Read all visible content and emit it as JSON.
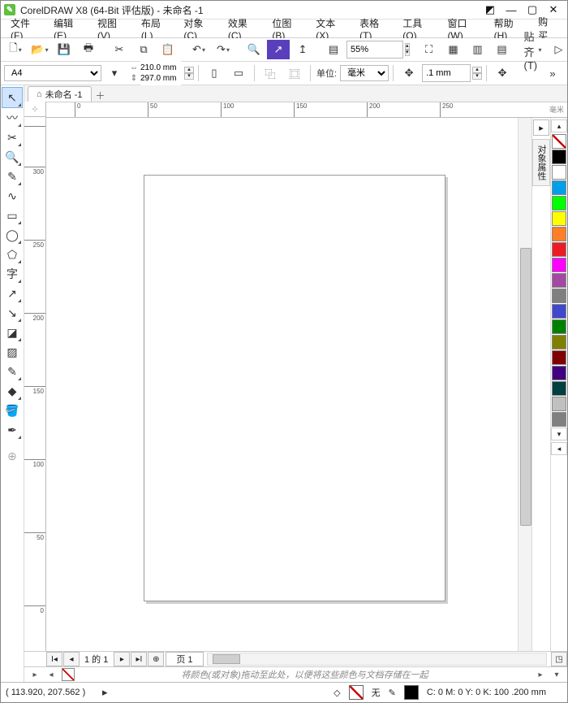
{
  "title": "CorelDRAW X8 (64-Bit 评估版) - 未命名 -1",
  "menu": [
    "文件(F)",
    "编辑(E)",
    "视图(V)",
    "布局(L)",
    "对象(C)",
    "效果(C)",
    "位图(B)",
    "文本(X)",
    "表格(T)",
    "工具(O)",
    "窗口(W)",
    "帮助(H)",
    "购买"
  ],
  "toolbar1": {
    "zoom": "55%",
    "paste_label": "贴齐(T)"
  },
  "propbar": {
    "page_size": "A4",
    "width": "210.0 mm",
    "height": "297.0 mm",
    "unit_label": "单位:",
    "unit_value": "毫米",
    "nudge": ".1 mm"
  },
  "doc_tab": "未命名 -1",
  "ruler_unit": "毫米",
  "hruler_ticks": [
    {
      "pos": 36,
      "label": "0"
    },
    {
      "pos": 126,
      "label": "50"
    },
    {
      "pos": 216,
      "label": "100"
    },
    {
      "pos": 306,
      "label": "150"
    },
    {
      "pos": 396,
      "label": "200"
    },
    {
      "pos": 486,
      "label": "250"
    }
  ],
  "vruler_ticks": [
    {
      "pos": 10,
      "label": ""
    },
    {
      "pos": 60,
      "label": "300"
    },
    {
      "pos": 150,
      "label": "250"
    },
    {
      "pos": 240,
      "label": "200"
    },
    {
      "pos": 330,
      "label": "150"
    },
    {
      "pos": 420,
      "label": "100"
    },
    {
      "pos": 510,
      "label": "50"
    },
    {
      "pos": 600,
      "label": "0"
    }
  ],
  "side_docker": "对象属性",
  "palette": [
    "#000000",
    "#ffffff",
    "#00a0e9",
    "#00ff00",
    "#ffff00",
    "#ff7f27",
    "#ed1c24",
    "#ff00ff",
    "#a349a4",
    "#7f7f7f",
    "#3f48cc",
    "#008000",
    "#808000",
    "#800000",
    "#400080",
    "#004040",
    "#c0c0c0",
    "#808080"
  ],
  "pager": {
    "count_text": "1 的 1",
    "page_tab": "页 1"
  },
  "hint": "将颜色(或对象)拖动至此处，以便将这些颜色与文档存储在一起",
  "status": {
    "coords": "( 113.920, 207.562 )",
    "fill_label": "无",
    "outline_info": "C: 0 M: 0 Y: 0 K: 100  .200 mm"
  }
}
